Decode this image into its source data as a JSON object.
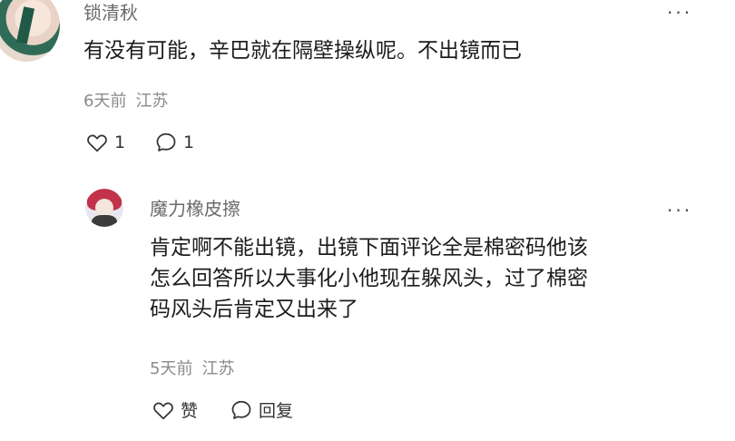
{
  "comment": {
    "username": "锁清秋",
    "text": "有没有可能，辛巴就在隔壁操纵呢。不出镜而已",
    "time": "6天前",
    "location": "江苏",
    "like_count": "1",
    "reply_count": "1",
    "more": "..."
  },
  "reply": {
    "username": "魔力橡皮擦",
    "lines": [
      "肯定啊不能出镜，出镜下面评论全是棉密码他该",
      "怎么回答所以大事化小他现在躲风头，过了棉密",
      "码风头后肯定又出来了"
    ],
    "time": "5天前",
    "location": "江苏",
    "like_label": "赞",
    "reply_label": "回复",
    "more": "..."
  },
  "icons": {
    "like": "heart-outline-icon",
    "comment": "chat-bubble-icon"
  }
}
